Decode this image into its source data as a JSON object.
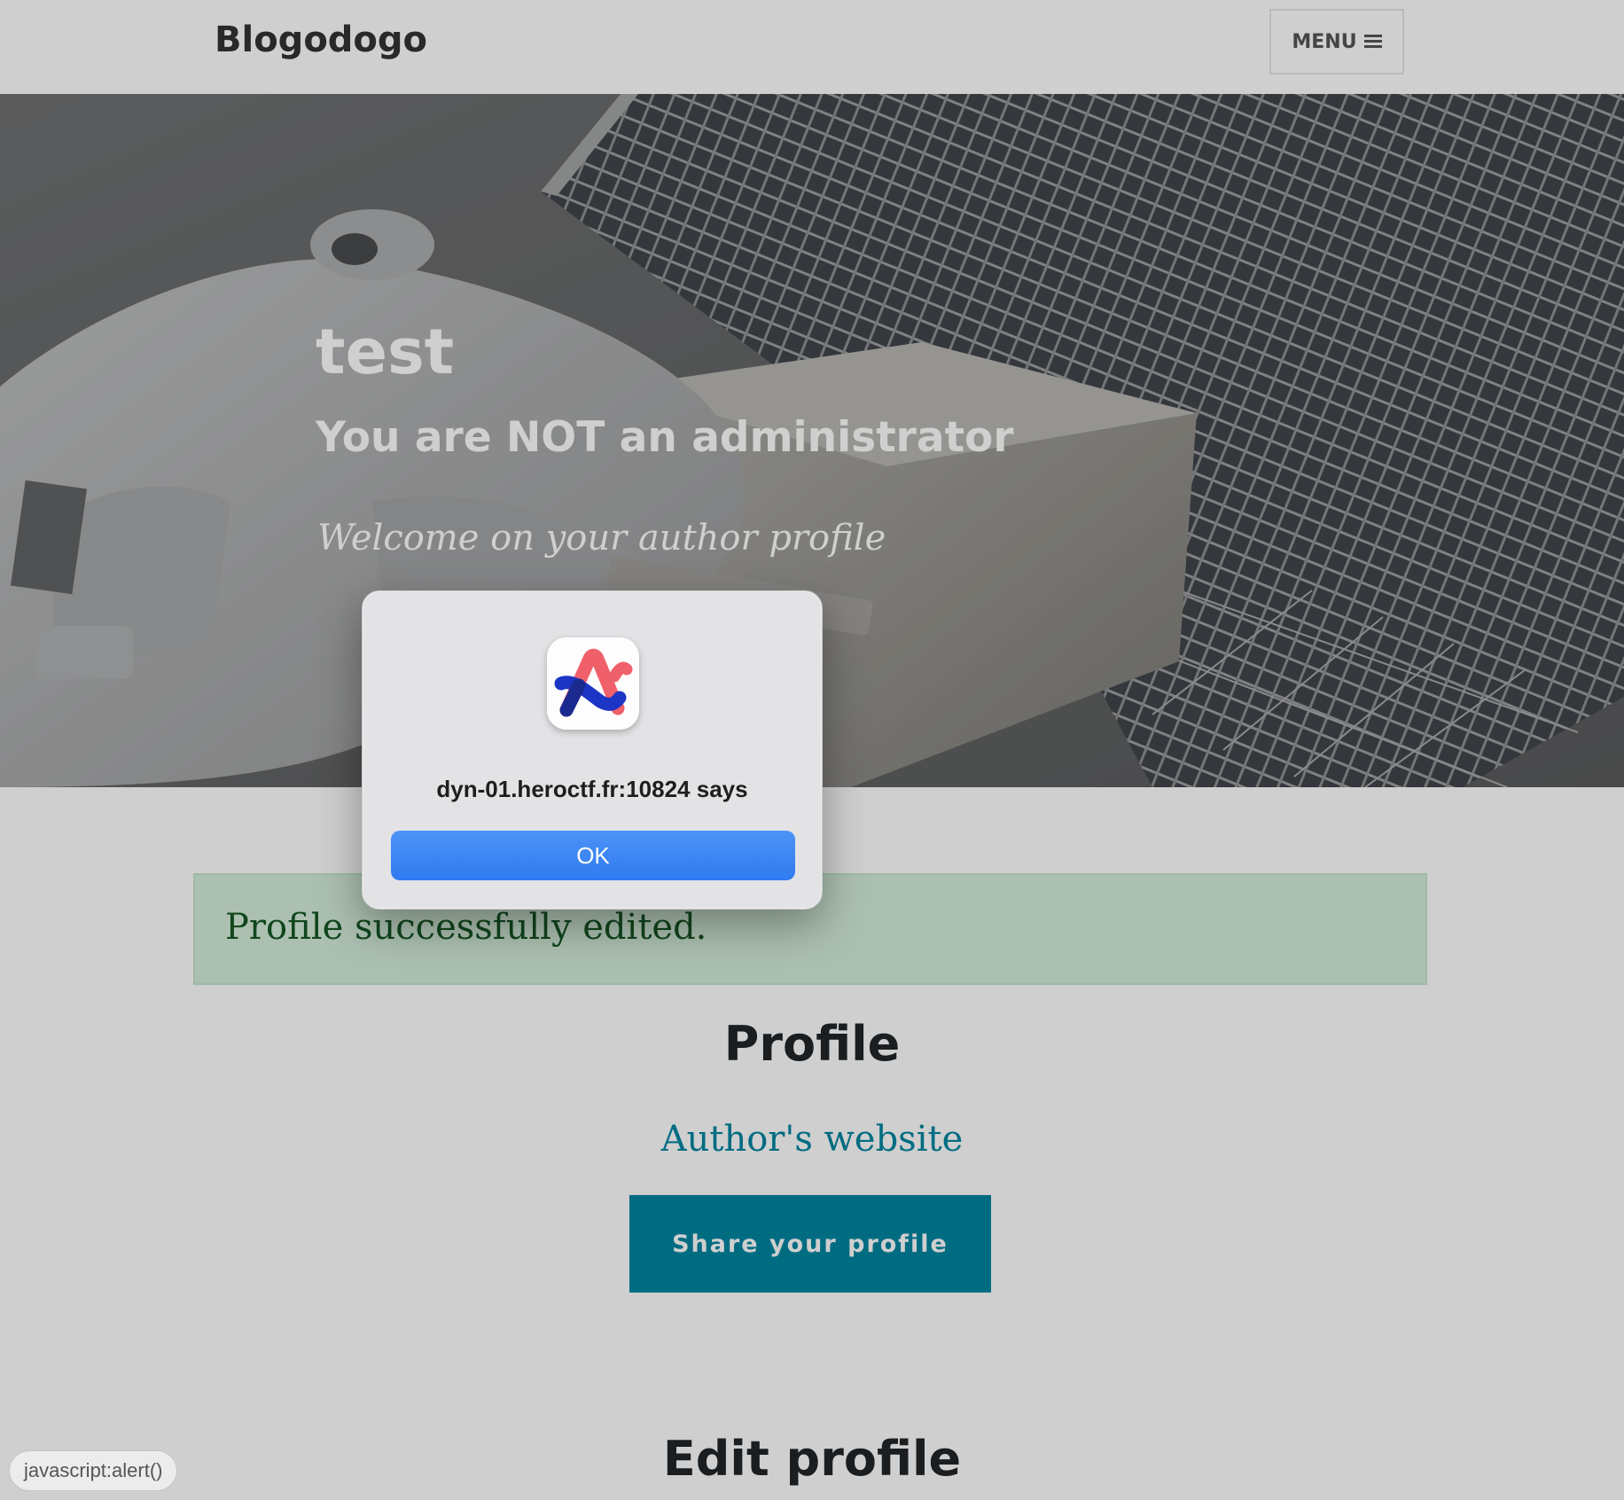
{
  "navbar": {
    "brand": "Blogodogo",
    "menu_label": "MENU",
    "menu_icon": "hamburger-icon"
  },
  "hero": {
    "title": "test",
    "subtitle": "You are NOT an administrator",
    "meta": "Welcome on your author profile",
    "background_image": "astronaut-spacewalk-solar-array-photo"
  },
  "alert": {
    "message": "Profile successfully edited."
  },
  "profile": {
    "heading": "Profile",
    "website_link": "Author's website",
    "share_button": "Share your profile"
  },
  "edit": {
    "heading": "Edit profile"
  },
  "dialog": {
    "icon": "arc-browser-icon",
    "message": "dyn-01.heroctf.fr:10824 says",
    "ok_label": "OK"
  },
  "status_bar": {
    "url": "javascript:alert()"
  },
  "colors": {
    "accent": "#0085a1",
    "alert_bg": "#d4edda",
    "alert_text": "#155724",
    "dialog_button": "#3a84f4"
  }
}
